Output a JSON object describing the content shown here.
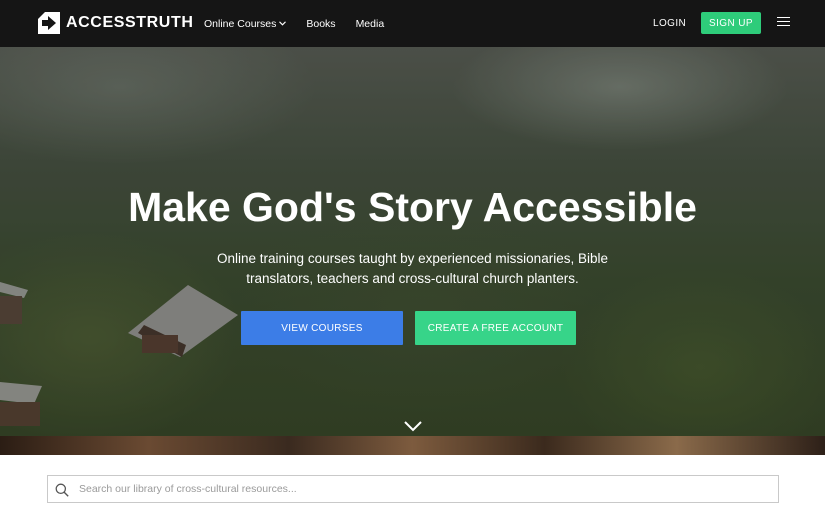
{
  "brand": {
    "name": "ACCESSTRUTH",
    "logo_icon": "accesstruth-logo-icon"
  },
  "nav": {
    "links": [
      {
        "label": "Online Courses",
        "has_dropdown": true
      },
      {
        "label": "Books",
        "has_dropdown": false
      },
      {
        "label": "Media",
        "has_dropdown": false
      }
    ],
    "login_label": "LOGIN",
    "signup_label": "SIGN UP",
    "menu_icon": "hamburger-menu-icon"
  },
  "hero": {
    "title": "Make God's Story Accessible",
    "subtitle": "Online training courses taught by experienced missionaries, Bible translators, teachers and cross-cultural church planters.",
    "primary_button": "VIEW COURSES",
    "secondary_button": "CREATE A FREE ACCOUNT",
    "scroll_icon": "chevron-down-icon"
  },
  "search": {
    "placeholder": "Search our library of cross-cultural resources...",
    "value": "",
    "icon": "search-icon"
  },
  "colors": {
    "navbar_bg": "#151515",
    "signup_green": "#2ecc7a",
    "view_courses_blue": "#3c7de7",
    "create_account_green": "#37d489"
  }
}
